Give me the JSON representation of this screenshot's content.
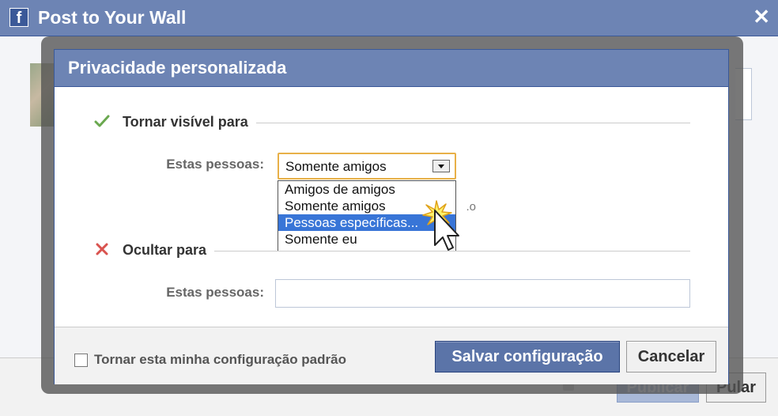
{
  "background_window": {
    "title": "Post to Your Wall",
    "app_icon": "facebook-icon",
    "app_icon_glyph": "f",
    "close_glyph": "✕",
    "publish_label": "Publicar",
    "skip_label": "Pular"
  },
  "dialog": {
    "title": "Privacidade personalizada",
    "visible_section": {
      "icon": "checkmark-icon",
      "title": "Tornar visível para",
      "field_label": "Estas pessoas:",
      "selected_value": "Somente amigos",
      "help_text_fragment": "o."
    },
    "dropdown": {
      "options": [
        "Amigos de amigos",
        "Somente amigos",
        "Pessoas específicas...",
        "Somente eu"
      ],
      "highlighted_index": 2
    },
    "hide_section": {
      "icon": "x-mark-icon",
      "title": "Ocultar para",
      "field_label": "Estas pessoas:",
      "input_value": ""
    },
    "footer": {
      "default_checkbox_label": "Tornar esta minha configuração padrão",
      "default_checkbox_checked": false,
      "save_label": "Salvar configuração",
      "cancel_label": "Cancelar"
    }
  },
  "colors": {
    "facebook_blue": "#6d84b4",
    "facebook_dark_blue": "#3b5998",
    "highlight_blue": "#3875d7",
    "focus_orange": "#e8b048",
    "check_green": "#6aa84f",
    "x_red": "#d9534f"
  }
}
